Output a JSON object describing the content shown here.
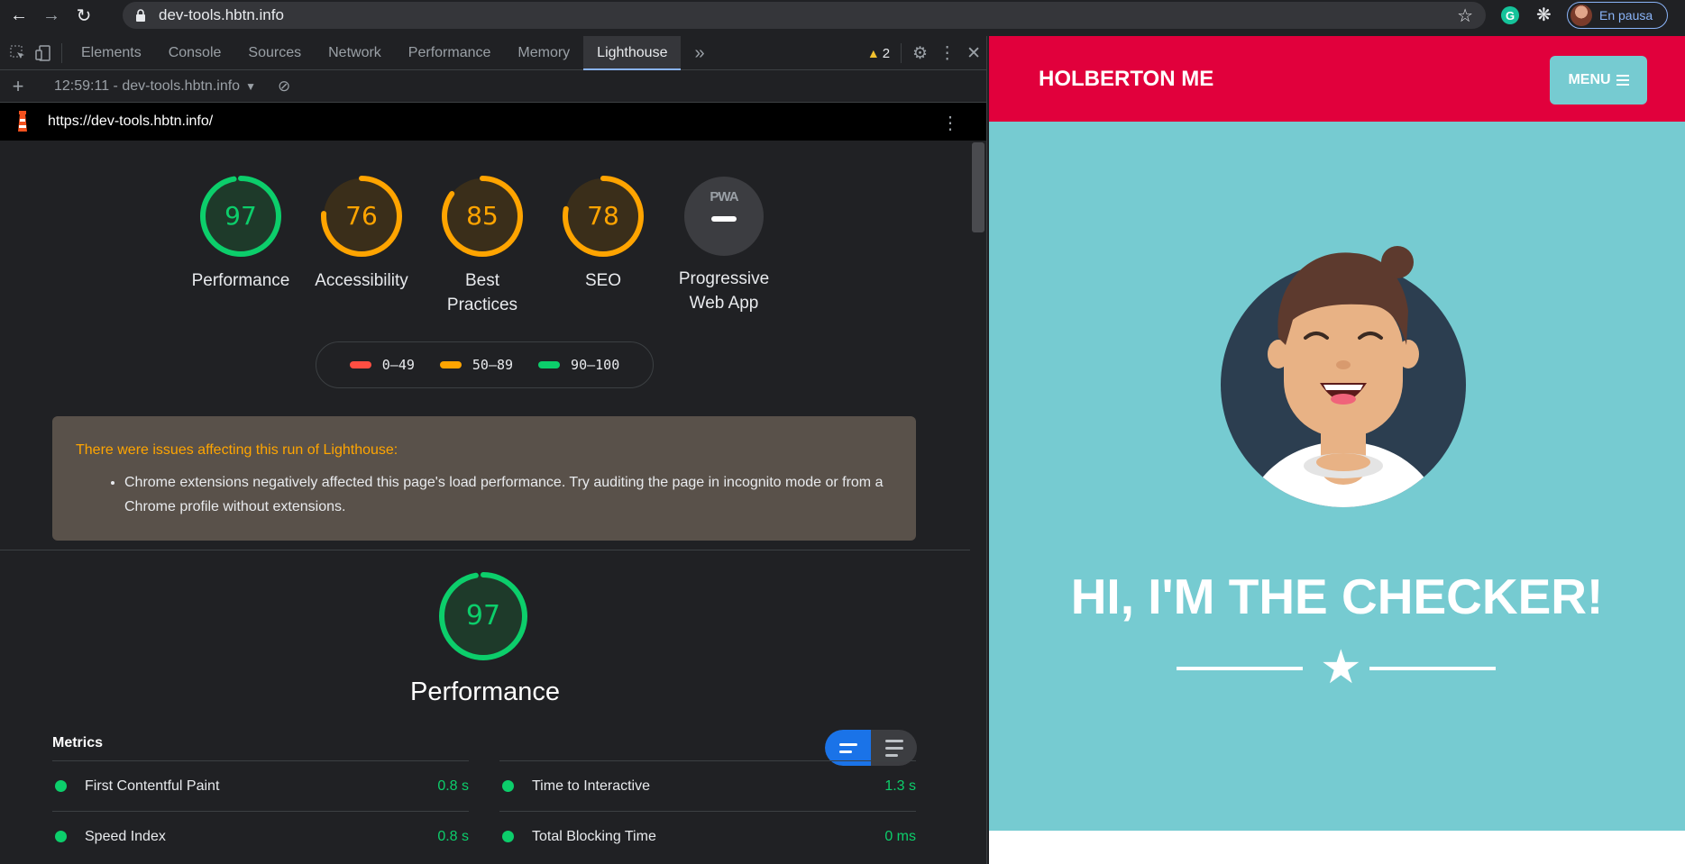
{
  "browser": {
    "url": "dev-tools.hbtn.info",
    "profile_label": "En pausa",
    "ext_grammarly": "G"
  },
  "devtools": {
    "tabs": [
      "Elements",
      "Console",
      "Sources",
      "Network",
      "Performance",
      "Memory",
      "Lighthouse"
    ],
    "active_tab": "Lighthouse",
    "more_tabs": "»",
    "warnings_count": "2",
    "report_run": "12:59:11 - dev-tools.hbtn.info",
    "report_url": "https://dev-tools.hbtn.info/"
  },
  "lighthouse": {
    "gauges": [
      {
        "label": "Performance",
        "score": "97",
        "value": 97,
        "status": "pass"
      },
      {
        "label": "Accessibility",
        "score": "76",
        "value": 76,
        "status": "average"
      },
      {
        "label": "Best Practices",
        "score": "85",
        "value": 85,
        "status": "average"
      },
      {
        "label": "SEO",
        "score": "78",
        "value": 78,
        "status": "average"
      },
      {
        "label": "Progressive Web App",
        "score": "PWA",
        "status": "na"
      }
    ],
    "legend": [
      {
        "range": "0–49",
        "color": "#ff4e42"
      },
      {
        "range": "50–89",
        "color": "#ffa400"
      },
      {
        "range": "90–100",
        "color": "#0cce6b"
      }
    ],
    "warning_title": "There were issues affecting this run of Lighthouse:",
    "warning_items": [
      "Chrome extensions negatively affected this page's load performance. Try auditing the page in incognito mode or from a Chrome profile without extensions."
    ],
    "category_score": "97",
    "category_value": 97,
    "category_title": "Performance",
    "metrics_label": "Metrics",
    "metrics": [
      {
        "name": "First Contentful Paint",
        "value": "0.8 s"
      },
      {
        "name": "Time to Interactive",
        "value": "1.3 s"
      },
      {
        "name": "Speed Index",
        "value": "0.8 s"
      },
      {
        "name": "Total Blocking Time",
        "value": "0 ms"
      }
    ]
  },
  "colors": {
    "pass": "#0cce6b",
    "average": "#ffa400",
    "fail": "#ff4e42",
    "page_header": "#e1003c",
    "page_bg": "#76cbd1"
  },
  "page": {
    "brand": "HOLBERTON ME",
    "menu_label": "MENU",
    "hero": "HI, I'M THE CHECKER!"
  }
}
